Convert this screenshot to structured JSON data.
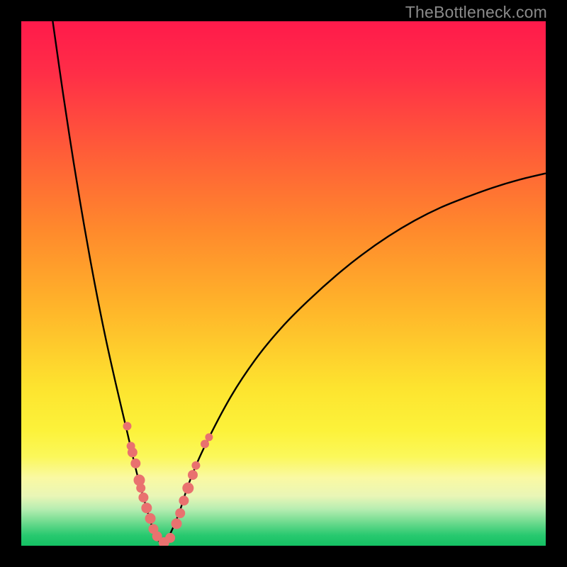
{
  "watermark": "TheBottleneck.com",
  "colors": {
    "black": "#000000",
    "curve": "#000000",
    "dot": "#e9716f",
    "gradient_stops": [
      {
        "offset": 0.0,
        "color": "#ff1a4b"
      },
      {
        "offset": 0.1,
        "color": "#ff2e47"
      },
      {
        "offset": 0.25,
        "color": "#ff5d38"
      },
      {
        "offset": 0.4,
        "color": "#ff8a2c"
      },
      {
        "offset": 0.55,
        "color": "#ffb62a"
      },
      {
        "offset": 0.7,
        "color": "#fde42f"
      },
      {
        "offset": 0.78,
        "color": "#fcf23a"
      },
      {
        "offset": 0.83,
        "color": "#fbf85a"
      },
      {
        "offset": 0.87,
        "color": "#faf9a2"
      },
      {
        "offset": 0.905,
        "color": "#e9f6b6"
      },
      {
        "offset": 0.93,
        "color": "#b7edb1"
      },
      {
        "offset": 0.955,
        "color": "#6fdb8f"
      },
      {
        "offset": 0.98,
        "color": "#28c96f"
      },
      {
        "offset": 1.0,
        "color": "#14c063"
      }
    ]
  },
  "chart_data": {
    "type": "line",
    "title": "",
    "xlabel": "",
    "ylabel": "",
    "xlim": [
      0,
      100
    ],
    "ylim": [
      0,
      100
    ],
    "note": "V-shaped bottleneck curve; minimum (best match) around x≈27 where y approaches 0. Left branch rises steeply to ~100 at x≈6; right branch rises to ~71 at x=100.",
    "series": [
      {
        "name": "left-branch",
        "x": [
          6,
          8,
          10,
          12,
          14,
          16,
          18,
          20,
          22,
          23.5,
          25,
          26,
          27
        ],
        "y": [
          100,
          86,
          73,
          61,
          50,
          40,
          31,
          22.5,
          14,
          8.5,
          3.5,
          1.2,
          0.3
        ]
      },
      {
        "name": "right-branch",
        "x": [
          27,
          28,
          30,
          32,
          35,
          40,
          45,
          50,
          55,
          60,
          65,
          70,
          75,
          80,
          85,
          90,
          95,
          100
        ],
        "y": [
          0.3,
          1.5,
          6,
          12,
          19,
          28.5,
          36,
          42,
          47,
          51.5,
          55.5,
          59,
          62,
          64.5,
          66.5,
          68.3,
          69.8,
          71
        ]
      }
    ],
    "points": {
      "name": "highlighted-dots",
      "coords": [
        {
          "x": 20.2,
          "y": 22.8,
          "r": 6
        },
        {
          "x": 20.9,
          "y": 19.0,
          "r": 6
        },
        {
          "x": 21.2,
          "y": 17.8,
          "r": 7
        },
        {
          "x": 21.8,
          "y": 15.7,
          "r": 7
        },
        {
          "x": 22.5,
          "y": 12.5,
          "r": 8
        },
        {
          "x": 22.8,
          "y": 11.0,
          "r": 6.5
        },
        {
          "x": 23.3,
          "y": 9.2,
          "r": 7
        },
        {
          "x": 23.9,
          "y": 7.2,
          "r": 7.5
        },
        {
          "x": 24.6,
          "y": 5.2,
          "r": 7.5
        },
        {
          "x": 25.2,
          "y": 3.2,
          "r": 7
        },
        {
          "x": 25.9,
          "y": 1.8,
          "r": 7
        },
        {
          "x": 27.2,
          "y": 0.6,
          "r": 7.5
        },
        {
          "x": 28.4,
          "y": 1.5,
          "r": 7
        },
        {
          "x": 29.6,
          "y": 4.2,
          "r": 7.5
        },
        {
          "x": 30.3,
          "y": 6.2,
          "r": 7
        },
        {
          "x": 31.0,
          "y": 8.6,
          "r": 7
        },
        {
          "x": 31.8,
          "y": 11.0,
          "r": 8
        },
        {
          "x": 32.7,
          "y": 13.5,
          "r": 7
        },
        {
          "x": 33.3,
          "y": 15.3,
          "r": 6
        },
        {
          "x": 35.0,
          "y": 19.4,
          "r": 6
        },
        {
          "x": 35.8,
          "y": 20.7,
          "r": 5.5
        }
      ]
    }
  }
}
